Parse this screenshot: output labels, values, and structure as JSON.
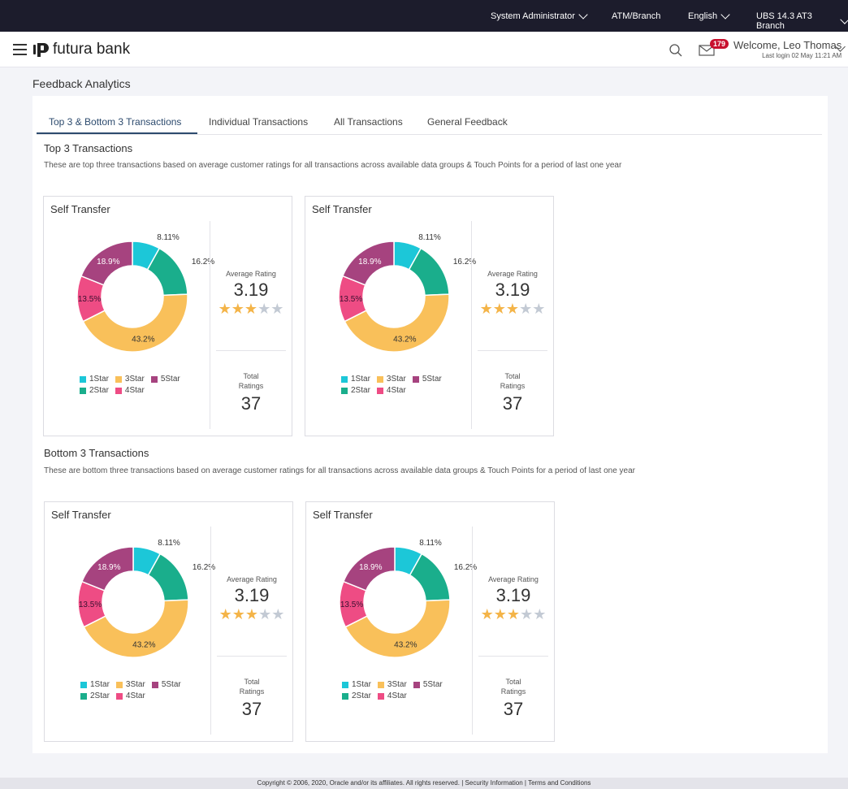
{
  "topbar": {
    "role": "System Administrator",
    "branch": "ATM/Branch",
    "language": "English",
    "ubs": "UBS 14.3 AT3 Branch"
  },
  "header": {
    "brand": "futura bank",
    "notifications_count": "179",
    "welcome": "Welcome, Leo Thomas",
    "last_login": "Last login 02 May 11:21 AM"
  },
  "page": {
    "title": "Feedback Analytics"
  },
  "tabs": [
    {
      "label": "Top 3 & Bottom 3 Transactions"
    },
    {
      "label": "Individual Transactions"
    },
    {
      "label": "All Transactions"
    },
    {
      "label": "General Feedback"
    }
  ],
  "top_section": {
    "title": "Top 3 Transactions",
    "description": "These are top three transactions based on average customer ratings for all transactions across available data groups & Touch Points for a period of last one year"
  },
  "bottom_section": {
    "title": "Bottom 3 Transactions",
    "description": "These are bottom three transactions based on average customer ratings for all transactions across available data groups & Touch Points for a period of last one year"
  },
  "labels": {
    "average_rating": "Average Rating",
    "total": "Total",
    "ratings": "Ratings"
  },
  "colors": {
    "1Star": "#1cc7d8",
    "2Star": "#1aae8c",
    "3Star": "#f9c05a",
    "4Star": "#ee4c84",
    "5Star": "#a6437f"
  },
  "cards": [
    {
      "title": "Self Transfer",
      "average": "3.19",
      "stars": 3,
      "total": "37"
    },
    {
      "title": "Self Transfer",
      "average": "3.19",
      "stars": 3,
      "total": "37"
    },
    {
      "title": "Self Transfer",
      "average": "3.19",
      "stars": 3,
      "total": "37"
    },
    {
      "title": "Self Transfer",
      "average": "3.19",
      "stars": 3,
      "total": "37"
    }
  ],
  "chart_data": {
    "type": "pie",
    "variant": "donut",
    "categories": [
      "1Star",
      "2Star",
      "3Star",
      "4Star",
      "5Star"
    ],
    "values": [
      8.11,
      16.2,
      43.2,
      13.5,
      18.9
    ],
    "labels": [
      "8.11%",
      "16.2%",
      "43.2%",
      "13.5%",
      "18.9%"
    ],
    "legend_position": "bottom"
  },
  "footer": {
    "copyright": "Copyright © 2006, 2020, Oracle and/or its affiliates. All rights reserved.",
    "security": "Security Information",
    "terms": "Terms and Conditions"
  }
}
